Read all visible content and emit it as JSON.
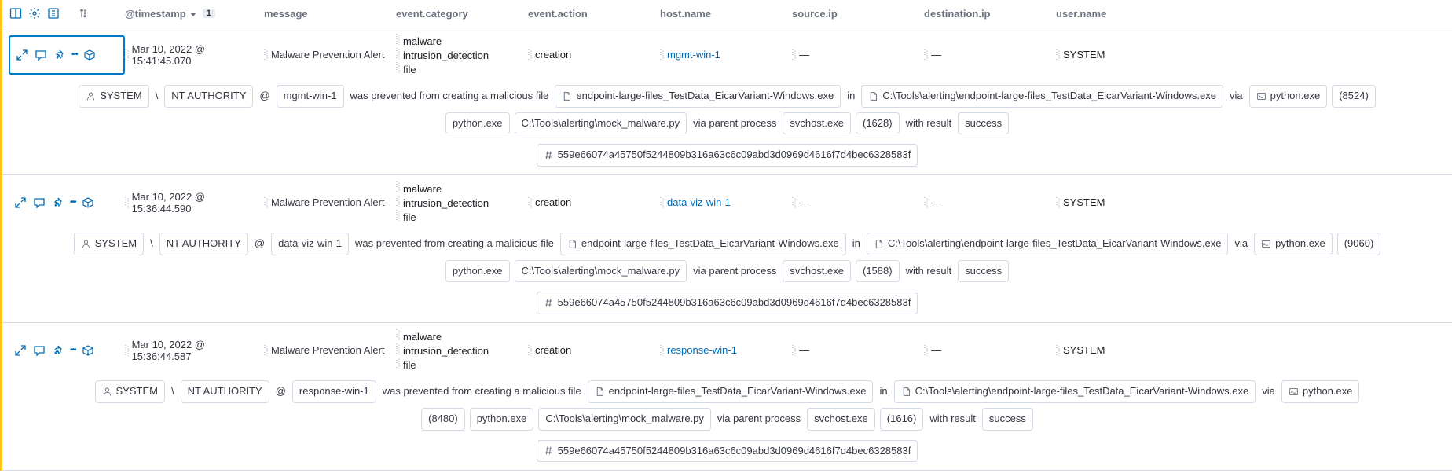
{
  "columns": {
    "timestamp": "@timestamp",
    "sort_badge": "1",
    "message": "message",
    "category": "event.category",
    "action": "event.action",
    "hostname": "host.name",
    "sourceip": "source.ip",
    "destip": "destination.ip",
    "username": "user.name"
  },
  "rows": [
    {
      "ts": "Mar 10, 2022 @ 15:41:45.070",
      "message": "Malware Prevention Alert",
      "cat": [
        "malware",
        "intrusion_detection",
        "file"
      ],
      "action": "creation",
      "host": "mgmt-win-1",
      "sip": "—",
      "dip": "—",
      "user": "SYSTEM",
      "d": {
        "sys": "SYSTEM",
        "auth": "NT AUTHORITY",
        "host": "mgmt-win-1",
        "prev": "was prevented from creating a malicious file",
        "exe": "endpoint-large-files_TestData_EicarVariant-Windows.exe",
        "in": "in",
        "path": "C:\\Tools\\alerting\\endpoint-large-files_TestData_EicarVariant-Windows.exe",
        "via": "via",
        "py": "python.exe",
        "pid": "(8524)",
        "py2": "python.exe",
        "mm": "C:\\Tools\\alerting\\mock_malware.py",
        "viap": "via parent process",
        "svc": "svchost.exe",
        "ppid": "(1628)",
        "wr": "with result",
        "succ": "success",
        "hash": "559e66074a45750f5244809b316a63c6c09abd3d0969d4616f7d4bec6328583f"
      },
      "selected": true
    },
    {
      "ts": "Mar 10, 2022 @ 15:36:44.590",
      "message": "Malware Prevention Alert",
      "cat": [
        "malware",
        "intrusion_detection",
        "file"
      ],
      "action": "creation",
      "host": "data-viz-win-1",
      "sip": "—",
      "dip": "—",
      "user": "SYSTEM",
      "d": {
        "sys": "SYSTEM",
        "auth": "NT AUTHORITY",
        "host": "data-viz-win-1",
        "prev": "was prevented from creating a malicious file",
        "exe": "endpoint-large-files_TestData_EicarVariant-Windows.exe",
        "in": "in",
        "path": "C:\\Tools\\alerting\\endpoint-large-files_TestData_EicarVariant-Windows.exe",
        "via": "via",
        "py": "python.exe",
        "pid": "(9060)",
        "py2": "python.exe",
        "mm": "C:\\Tools\\alerting\\mock_malware.py",
        "viap": "via parent process",
        "svc": "svchost.exe",
        "ppid": "(1588)",
        "wr": "with result",
        "succ": "success",
        "hash": "559e66074a45750f5244809b316a63c6c09abd3d0969d4616f7d4bec6328583f"
      },
      "selected": false
    },
    {
      "ts": "Mar 10, 2022 @ 15:36:44.587",
      "message": "Malware Prevention Alert",
      "cat": [
        "malware",
        "intrusion_detection",
        "file"
      ],
      "action": "creation",
      "host": "response-win-1",
      "sip": "—",
      "dip": "—",
      "user": "SYSTEM",
      "d": {
        "sys": "SYSTEM",
        "auth": "NT AUTHORITY",
        "host": "response-win-1",
        "prev": "was prevented from creating a malicious file",
        "exe": "endpoint-large-files_TestData_EicarVariant-Windows.exe",
        "in": "in",
        "path": "C:\\Tools\\alerting\\endpoint-large-files_TestData_EicarVariant-Windows.exe",
        "via": "via",
        "py": "python.exe",
        "pid": "(8480)",
        "py2": "python.exe",
        "mm": "C:\\Tools\\alerting\\mock_malware.py",
        "viap": "via parent process",
        "svc": "svchost.exe",
        "ppid": "(1616)",
        "wr": "with result",
        "succ": "success",
        "hash": "559e66074a45750f5244809b316a63c6c09abd3d0969d4616f7d4bec6328583f"
      },
      "selected": false
    }
  ]
}
